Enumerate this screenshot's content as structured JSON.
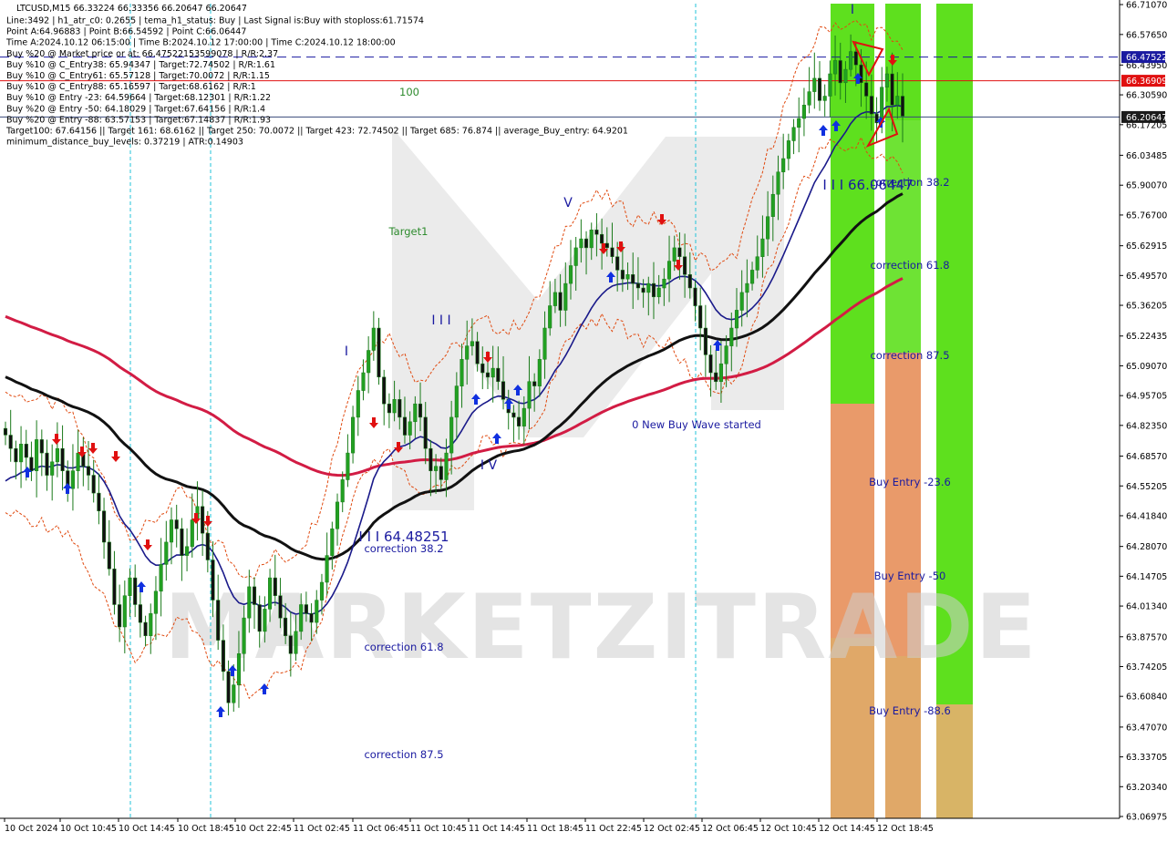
{
  "chart_data": {
    "type": "candlestick",
    "symbol_line": "LTCUSD,M15  66.33224 66.33356 66.20647 66.20647",
    "info_lines": [
      "Line:3492 | h1_atr_c0: 0.2655 | tema_h1_status: Buy | Last Signal is:Buy with stoploss:61.71574",
      "Point A:64.96883 | Point B:66.54592 | Point C:66.06447",
      "Time A:2024.10.12 06:15:00 | Time B:2024.10.12 17:00:00 | Time C:2024.10.12 18:00:00",
      "Buy %20 @ Market price or at: 66.47522153599078 | R/R:2.37",
      "Buy %10 @ C_Entry38: 65.94347 | Target:72.74502 | R/R:1.61",
      "Buy %10 @ C_Entry61: 65.57128 | Target:70.0072 | R/R:1.15",
      "Buy %10 @ C_Entry88: 65.16597 | Target:68.6162 | R/R:1",
      "Buy %10 @ Entry -23: 64.59664 | Target:68.12301 | R/R:1.22",
      "Buy %20 @ Entry -50: 64.18029 | Target:67.64156 | R/R:1.4",
      "Buy %20 @ Entry -88: 63.57153 | Target:67.14837 | R/R:1.93",
      "Target100: 67.64156 || Target 161: 68.6162 || Target 250: 70.0072 || Target 423: 72.74502 || Target 685: 76.874 || average_Buy_entry: 64.9201",
      "minimum_distance_buy_levels: 0.37219 | ATR:0.14903"
    ],
    "y_axis": {
      "range": [
        63.06975,
        66.7107
      ],
      "ticks": [
        "66.71070",
        "66.57650",
        "66.43950",
        "66.30590",
        "66.17205",
        "66.03485",
        "65.90070",
        "65.76700",
        "65.62915",
        "65.49570",
        "65.36205",
        "65.22435",
        "65.09070",
        "64.95705",
        "64.82350",
        "64.68570",
        "64.55205",
        "64.41840",
        "64.28070",
        "64.14705",
        "64.01340",
        "63.87570",
        "63.74205",
        "63.60840",
        "63.47070",
        "63.33705",
        "63.20340",
        "63.06975"
      ]
    },
    "x_axis": {
      "ticks": [
        "10 Oct 2024",
        "10 Oct 10:45",
        "10 Oct 14:45",
        "10 Oct 18:45",
        "10 Oct 22:45",
        "11 Oct 02:45",
        "11 Oct 06:45",
        "11 Oct 10:45",
        "11 Oct 14:45",
        "11 Oct 18:45",
        "11 Oct 22:45",
        "12 Oct 02:45",
        "12 Oct 06:45",
        "12 Oct 10:45",
        "12 Oct 14:45",
        "12 Oct 18:45"
      ]
    },
    "price_labels": [
      {
        "value": "66.47522",
        "color": "#1a1aa0"
      },
      {
        "value": "66.36909",
        "color": "#e01010"
      },
      {
        "value": "66.20647",
        "color": "#1a1a1a"
      }
    ],
    "closes": [
      64.78,
      64.72,
      64.66,
      64.74,
      64.68,
      64.62,
      64.76,
      64.7,
      64.6,
      64.66,
      64.72,
      64.62,
      64.54,
      64.62,
      64.7,
      64.64,
      64.6,
      64.52,
      64.44,
      64.3,
      64.18,
      64.02,
      63.92,
      64.06,
      64.14,
      64.02,
      63.94,
      63.88,
      63.98,
      64.08,
      64.2,
      64.3,
      64.4,
      64.36,
      64.24,
      64.28,
      64.4,
      64.46,
      64.34,
      64.22,
      64.04,
      63.86,
      63.72,
      63.58,
      63.66,
      63.8,
      63.96,
      64.1,
      64.02,
      63.9,
      64.0,
      64.14,
      64.06,
      63.96,
      63.88,
      63.8,
      63.9,
      64.02,
      63.98,
      63.94,
      64.04,
      64.12,
      64.24,
      64.36,
      64.48,
      64.58,
      64.7,
      64.86,
      64.98,
      65.06,
      65.16,
      65.26,
      65.04,
      64.92,
      64.88,
      64.94,
      64.86,
      64.78,
      64.84,
      64.92,
      64.86,
      64.72,
      64.62,
      64.64,
      64.58,
      64.7,
      64.86,
      65.0,
      65.12,
      65.18,
      65.2,
      65.1,
      65.06,
      65.04,
      65.08,
      65.02,
      64.94,
      64.88,
      64.86,
      64.82,
      64.9,
      65.02,
      65.0,
      65.12,
      65.26,
      65.36,
      65.42,
      65.34,
      65.46,
      65.54,
      65.62,
      65.66,
      65.62,
      65.7,
      65.68,
      65.64,
      65.62,
      65.58,
      65.52,
      65.48,
      65.5,
      65.46,
      65.44,
      65.42,
      65.46,
      65.4,
      65.44,
      65.48,
      65.56,
      65.62,
      65.58,
      65.5,
      65.44,
      65.36,
      65.26,
      65.14,
      65.06,
      65.02,
      65.1,
      65.18,
      65.26,
      65.34,
      65.42,
      65.46,
      65.52,
      65.58,
      65.66,
      65.76,
      65.86,
      65.96,
      66.02,
      66.1,
      66.16,
      66.2,
      66.26,
      66.32,
      66.38,
      66.28,
      66.3,
      66.4,
      66.46,
      66.36,
      66.42,
      66.5,
      66.44,
      66.36,
      66.3,
      66.22,
      66.18,
      66.34,
      66.4,
      66.26,
      66.3,
      66.21
    ],
    "annotations": [
      {
        "text": "100",
        "color": "#2e8b2e"
      },
      {
        "text": "Target1",
        "color": "#2e8b2e"
      },
      {
        "text": "V",
        "color": "#1a1aa0"
      },
      {
        "text": "I I I",
        "color": "#1a1aa0"
      },
      {
        "text": "I",
        "color": "#1a1aa0"
      },
      {
        "text": "I V",
        "color": "#1a1aa0"
      },
      {
        "text": "I I I 64.48251",
        "color": "#1a1aa0"
      },
      {
        "text": "correction 38.2",
        "color": "#1a1aa0"
      },
      {
        "text": "correction 61.8",
        "color": "#1a1aa0"
      },
      {
        "text": "correction 87.5",
        "color": "#1a1aa0"
      },
      {
        "text": "0 New Buy Wave started",
        "color": "#1a1aa0"
      },
      {
        "text": "I I I 66.06447",
        "color": "#1a1aa0"
      },
      {
        "text": "correction 38.2",
        "color": "#1a1aa0"
      },
      {
        "text": "correction 61.8",
        "color": "#1a1aa0"
      },
      {
        "text": "correction 87.5",
        "color": "#1a1aa0"
      },
      {
        "text": "Buy Entry -23.6",
        "color": "#1a1aa0"
      },
      {
        "text": "Buy Entry -50",
        "color": "#1a1aa0"
      },
      {
        "text": "Buy Entry -88.6",
        "color": "#1a1aa0"
      },
      {
        "text": "I",
        "color": "#1a1aa0"
      }
    ],
    "watermark": "MARKETZITRADE",
    "colors": {
      "green_zone": "#5ee01e",
      "orange_zone": "#e99a6a",
      "tan_zone": "#d8b466",
      "ema_black": "#111111",
      "ema_red": "#d21c44",
      "ema_blue": "#1a1a8a",
      "band_orange": "#e04a10",
      "buy_arrow": "#1030e0",
      "sell_arrow": "#e01010"
    }
  }
}
